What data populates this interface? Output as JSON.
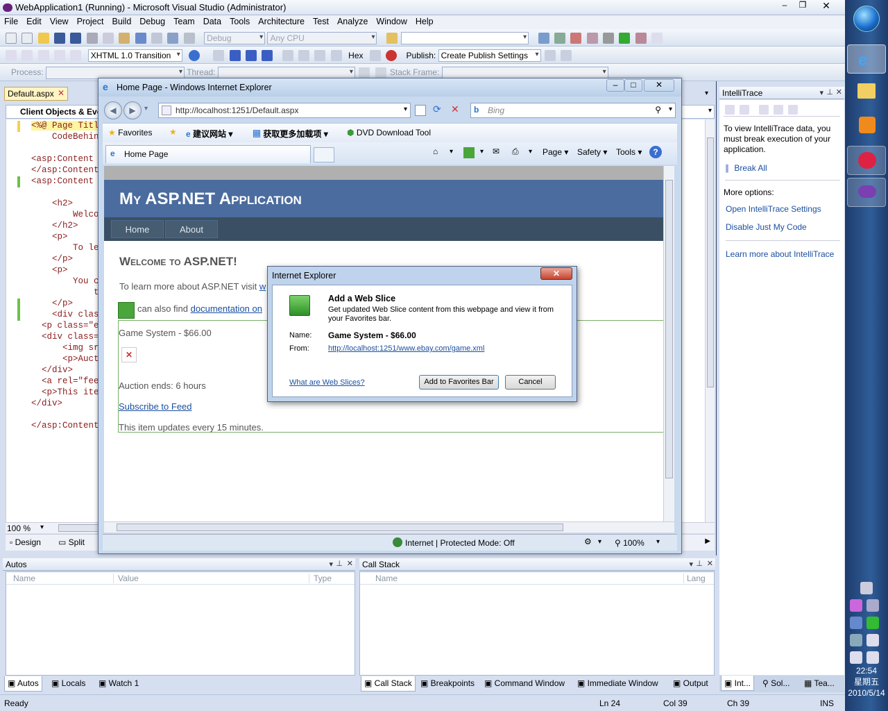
{
  "vs": {
    "title": "WebApplication1 (Running) - Microsoft Visual Studio (Administrator)",
    "menu": [
      "File",
      "Edit",
      "View",
      "Project",
      "Build",
      "Debug",
      "Team",
      "Data",
      "Tools",
      "Architecture",
      "Test",
      "Analyze",
      "Window",
      "Help"
    ],
    "toolbar": {
      "config": "Debug",
      "platform": "Any CPU",
      "doctype": "XHTML 1.0 Transition",
      "hex": "Hex",
      "publish_label": "Publish:",
      "publish_value": "Create Publish Settings",
      "process": "Process:",
      "thread": "Thread:",
      "stack_frame": "Stack Frame:"
    },
    "doc_tab": "Default.aspx",
    "client_objects": "Client Objects & Eve",
    "code_lines": [
      {
        "t": "<%@ Page Title",
        "mark": "y"
      },
      {
        "t": "    CodeBehind",
        "mark": ""
      },
      {
        "t": "",
        "mark": ""
      },
      {
        "t": "<asp:Content I",
        "mark": ""
      },
      {
        "t": "</asp:Content>",
        "mark": ""
      },
      {
        "t": "<asp:Content I",
        "mark": "g"
      },
      {
        "t": "",
        "mark": ""
      },
      {
        "t": "    <h2>",
        "mark": ""
      },
      {
        "t": "        Welcom",
        "mark": ""
      },
      {
        "t": "    </h2>",
        "mark": ""
      },
      {
        "t": "    <p>",
        "mark": ""
      },
      {
        "t": "        To lea",
        "mark": ""
      },
      {
        "t": "    </p>",
        "mark": ""
      },
      {
        "t": "    <p>",
        "mark": ""
      },
      {
        "t": "        You ca",
        "mark": ""
      },
      {
        "t": "            ti",
        "mark": ""
      },
      {
        "t": "    </p>",
        "mark": "g"
      },
      {
        "t": "    <div class",
        "mark": "g"
      },
      {
        "t": "  <p class=\"e",
        "mark": ""
      },
      {
        "t": "  <div class=",
        "mark": ""
      },
      {
        "t": "      <img src",
        "mark": ""
      },
      {
        "t": "      <p>Aucti",
        "mark": ""
      },
      {
        "t": "  </div>",
        "mark": ""
      },
      {
        "t": "  <a rel=\"fee",
        "mark": ""
      },
      {
        "t": "  <p>This ite",
        "mark": ""
      },
      {
        "t": "</div>",
        "mark": ""
      },
      {
        "t": "",
        "mark": ""
      },
      {
        "t": "</asp:Content>",
        "mark": ""
      }
    ],
    "zoom": "100 %",
    "view_tabs": [
      "Design",
      "Split"
    ],
    "status": {
      "ready": "Ready",
      "ln": "Ln 24",
      "col": "Col 39",
      "ch": "Ch 39",
      "ins": "INS"
    }
  },
  "intellitrace": {
    "title": "IntelliTrace",
    "message": "To view IntelliTrace data, you must break execution of your application.",
    "break_all": "Break All",
    "more": "More options:",
    "links": [
      "Open IntelliTrace Settings",
      "Disable Just My Code"
    ],
    "learn": "Learn more about IntelliTrace",
    "bottom_tabs": [
      "Int...",
      "Sol...",
      "Tea..."
    ]
  },
  "autos": {
    "title": "Autos",
    "cols": [
      "Name",
      "Value",
      "Type"
    ],
    "tabs": [
      "Autos",
      "Locals",
      "Watch 1"
    ]
  },
  "callstack": {
    "title": "Call Stack",
    "cols": [
      "Name",
      "Lang"
    ],
    "tabs": [
      "Call Stack",
      "Breakpoints",
      "Command Window",
      "Immediate Window",
      "Output"
    ]
  },
  "ie": {
    "title": "Home Page - Windows Internet Explorer",
    "url": "http://localhost:1251/Default.aspx",
    "search": "Bing",
    "favorites": "Favorites",
    "fav_items": [
      "建议网站 ▾",
      "获取更多加载项 ▾",
      "DVD Download Tool"
    ],
    "tab": "Home Page",
    "cmd": [
      "Page ▾",
      "Safety ▾",
      "Tools ▾"
    ],
    "status": "Internet | Protected Mode: Off",
    "zoom": "100%"
  },
  "site": {
    "app_title": "My ASP.NET Application",
    "nav": [
      "Home",
      "About"
    ],
    "heading": "Welcome to ASP.NET!",
    "learn": "To learn more about ASP.NET visit",
    "learn_link": "w",
    "find": "can also find",
    "find_link": "documentation on",
    "item": "Game System - $66.00",
    "auction": "Auction ends: 6 hours",
    "subscribe": "Subscribe to Feed",
    "updates": "This item updates every 15 minutes."
  },
  "dialog": {
    "title": "Internet Explorer",
    "heading": "Add a Web Slice",
    "desc": "Get updated Web Slice content from this webpage and view it from your Favorites bar.",
    "name_label": "Name:",
    "name_value": "Game System - $66.00",
    "from_label": "From:",
    "from_value": "http://localhost:1251/www.ebay.com/game.xml",
    "help": "What are Web Slices?",
    "add": "Add to Favorites Bar",
    "cancel": "Cancel"
  },
  "taskbar": {
    "time": "22:54",
    "day": "星期五",
    "date": "2010/5/14"
  }
}
